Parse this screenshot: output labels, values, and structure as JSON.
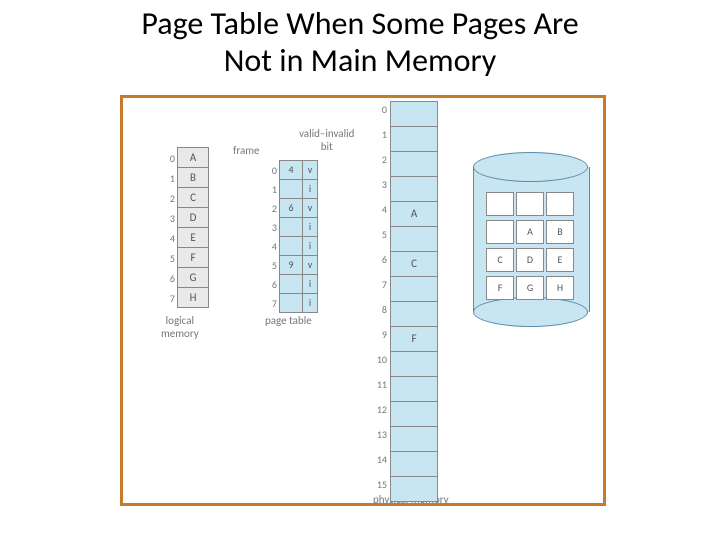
{
  "title_line1": "Page Table When Some Pages Are",
  "title_line2": "Not in Main Memory",
  "labels": {
    "logical_memory": "logical\nmemory",
    "page_table": "page table",
    "physical_memory": "physical memory",
    "frame": "frame",
    "valid_invalid_bit": "valid–invalid\nbit"
  },
  "logical_memory": [
    {
      "idx": "0",
      "page": "A"
    },
    {
      "idx": "1",
      "page": "B"
    },
    {
      "idx": "2",
      "page": "C"
    },
    {
      "idx": "3",
      "page": "D"
    },
    {
      "idx": "4",
      "page": "E"
    },
    {
      "idx": "5",
      "page": "F"
    },
    {
      "idx": "6",
      "page": "G"
    },
    {
      "idx": "7",
      "page": "H"
    }
  ],
  "page_table": [
    {
      "idx": "0",
      "frame": "4",
      "bit": "v"
    },
    {
      "idx": "1",
      "frame": "",
      "bit": "i"
    },
    {
      "idx": "2",
      "frame": "6",
      "bit": "v"
    },
    {
      "idx": "3",
      "frame": "",
      "bit": "i"
    },
    {
      "idx": "4",
      "frame": "",
      "bit": "i"
    },
    {
      "idx": "5",
      "frame": "9",
      "bit": "v"
    },
    {
      "idx": "6",
      "frame": "",
      "bit": "i"
    },
    {
      "idx": "7",
      "frame": "",
      "bit": "i"
    }
  ],
  "physical_memory": [
    {
      "idx": "0",
      "content": ""
    },
    {
      "idx": "1",
      "content": ""
    },
    {
      "idx": "2",
      "content": ""
    },
    {
      "idx": "3",
      "content": ""
    },
    {
      "idx": "4",
      "content": "A"
    },
    {
      "idx": "5",
      "content": ""
    },
    {
      "idx": "6",
      "content": "C"
    },
    {
      "idx": "7",
      "content": ""
    },
    {
      "idx": "8",
      "content": ""
    },
    {
      "idx": "9",
      "content": "F"
    },
    {
      "idx": "10",
      "content": ""
    },
    {
      "idx": "11",
      "content": ""
    },
    {
      "idx": "12",
      "content": ""
    },
    {
      "idx": "13",
      "content": ""
    },
    {
      "idx": "14",
      "content": ""
    },
    {
      "idx": "15",
      "content": ""
    }
  ],
  "disk": [
    "",
    "",
    "",
    "",
    "A",
    "B",
    "C",
    "D",
    "E",
    "F",
    "G",
    "H"
  ]
}
